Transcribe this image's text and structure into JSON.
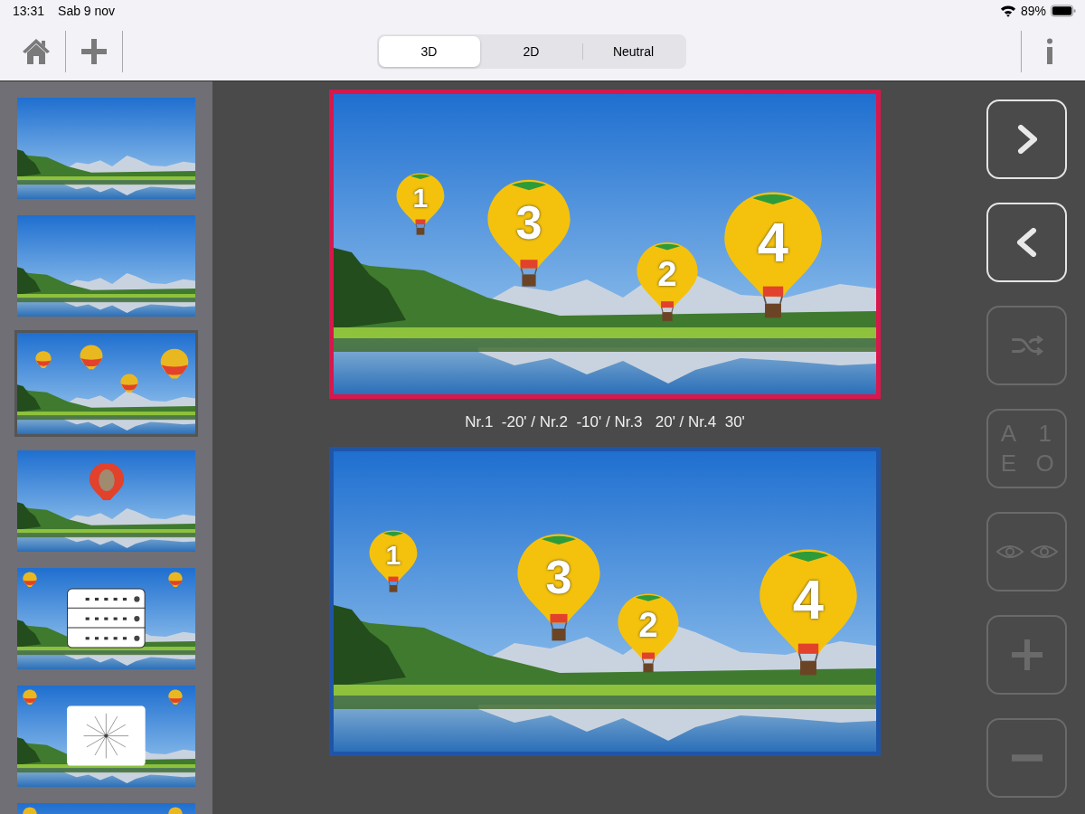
{
  "status_bar": {
    "time": "13:31",
    "date": "Sab 9 nov",
    "battery": "89%"
  },
  "toolbar": {
    "modes": [
      {
        "label": "3D",
        "selected": true
      },
      {
        "label": "2D",
        "selected": false
      },
      {
        "label": "Neutral",
        "selected": false
      }
    ]
  },
  "thumbnails": [
    {
      "kind": "landscape",
      "selected": false
    },
    {
      "kind": "landscape",
      "selected": false
    },
    {
      "kind": "balloons",
      "selected": true
    },
    {
      "kind": "single-balloon",
      "selected": false
    },
    {
      "kind": "letter-chart",
      "selected": false
    },
    {
      "kind": "fan-chart",
      "selected": false
    },
    {
      "kind": "corner-balloons",
      "selected": false
    }
  ],
  "top_image": {
    "balloons": [
      {
        "label": "1"
      },
      {
        "label": "3"
      },
      {
        "label": "2"
      },
      {
        "label": "4"
      }
    ]
  },
  "caption": "Nr.1  -20' / Nr.2  -10' / Nr.3   20' / Nr.4  30'",
  "bottom_image": {
    "balloons": [
      {
        "label": "1"
      },
      {
        "label": "3"
      },
      {
        "label": "2"
      },
      {
        "label": "4"
      }
    ]
  },
  "side_buttons": [
    {
      "kind": "next",
      "disabled": false
    },
    {
      "kind": "previous",
      "disabled": false
    },
    {
      "kind": "shuffle",
      "disabled": true
    },
    {
      "kind": "optotypes",
      "disabled": true,
      "glyphs": [
        "A",
        "1",
        "E",
        "O"
      ]
    },
    {
      "kind": "eyes",
      "disabled": true
    },
    {
      "kind": "plus",
      "disabled": true
    },
    {
      "kind": "minus",
      "disabled": true
    }
  ]
}
